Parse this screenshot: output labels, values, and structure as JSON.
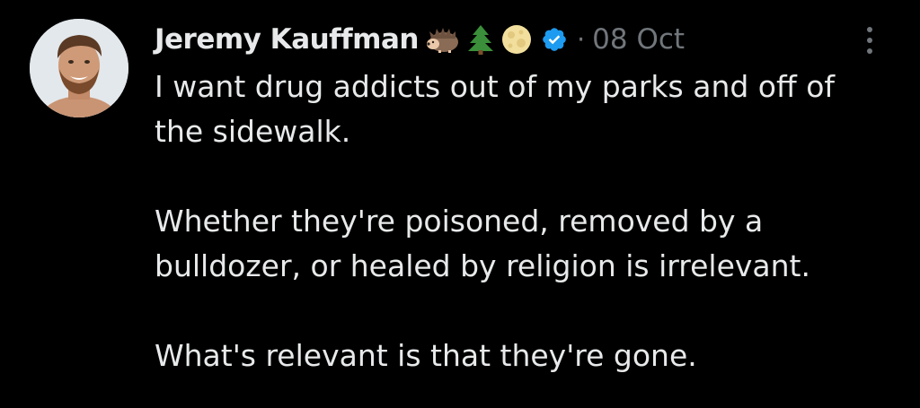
{
  "tweet": {
    "author_name": "Jeremy Kauffman",
    "name_emojis": [
      "hedgehog-icon",
      "evergreen-tree-icon",
      "full-moon-icon"
    ],
    "verified": true,
    "separator": "·",
    "date": "08 Oct",
    "paragraphs": [
      "I want drug addicts out of my parks and off of the sidewalk.",
      "Whether they're poisoned, removed by a bulldozer, or healed by religion is irrelevant.",
      "What's relevant is that they're gone."
    ]
  },
  "colors": {
    "background": "#000000",
    "text_primary": "#e7e9ea",
    "text_secondary": "#71767b",
    "verified_badge": "#1d9bf0"
  }
}
